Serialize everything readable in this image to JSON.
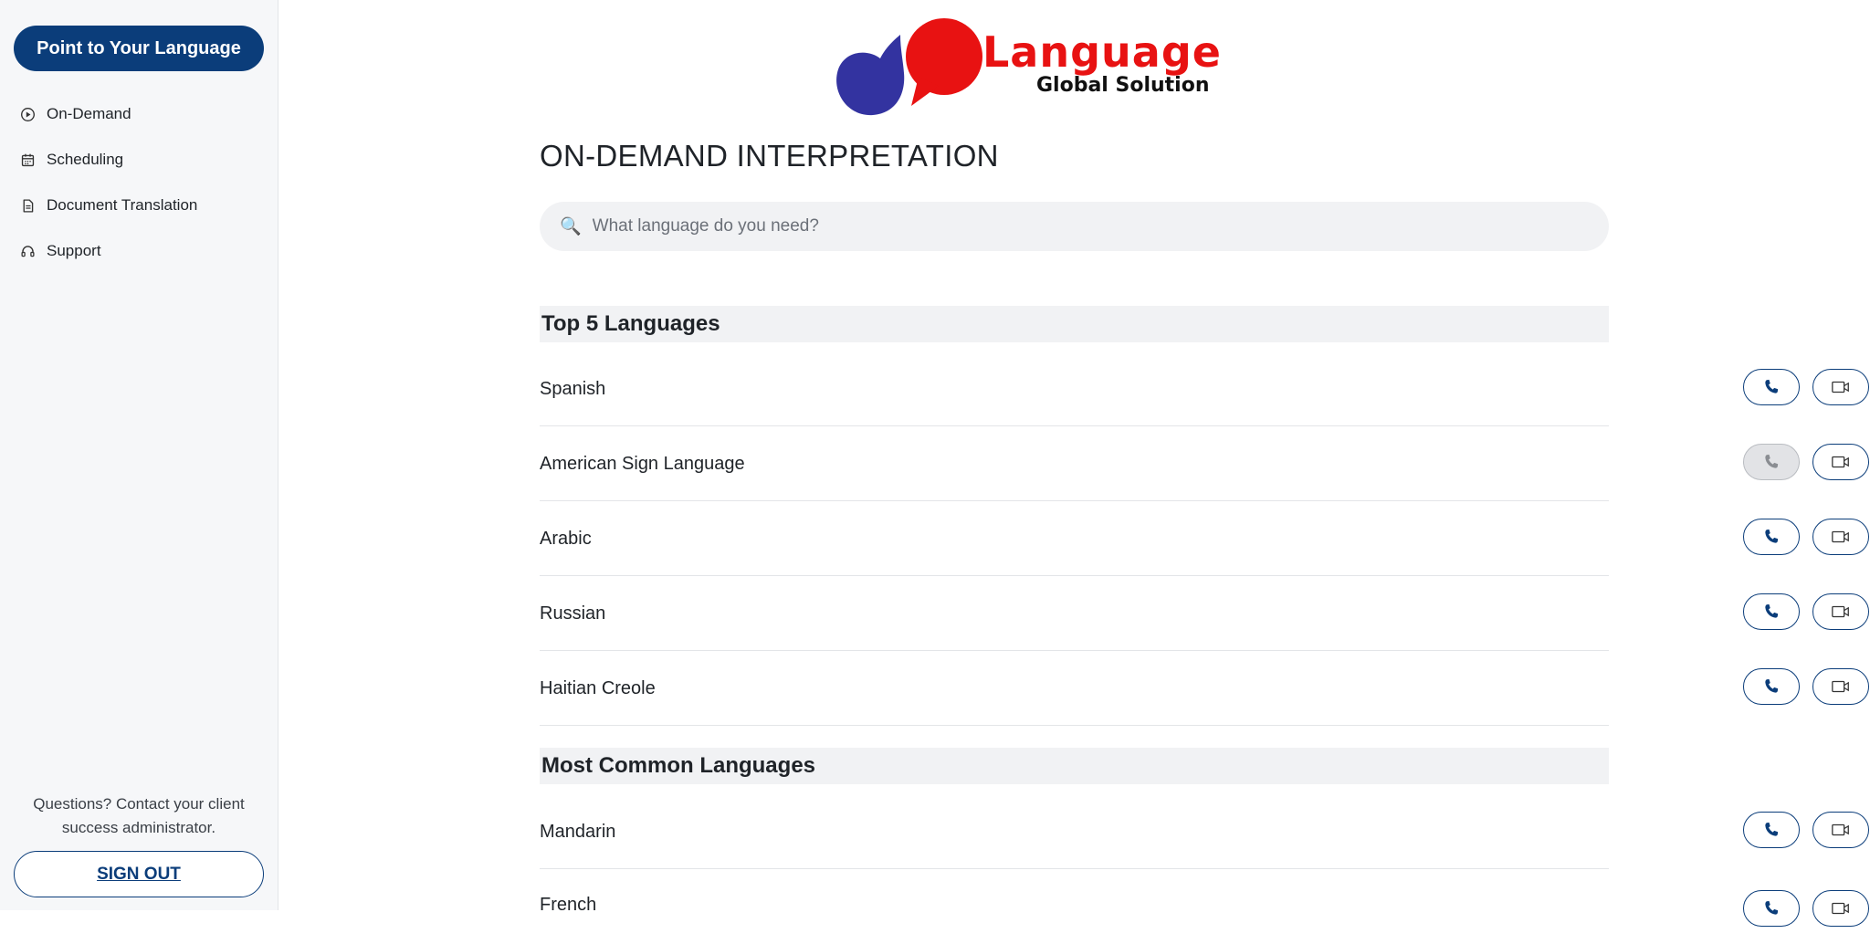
{
  "sidebar": {
    "brand_label": "Point to Your Language",
    "items": [
      {
        "label": "On-Demand",
        "icon": "play-circle-icon"
      },
      {
        "label": "Scheduling",
        "icon": "calendar-icon"
      },
      {
        "label": "Document Translation",
        "icon": "document-icon"
      },
      {
        "label": "Support",
        "icon": "headset-icon"
      }
    ],
    "help_text": "Questions? Contact your client success administrator.",
    "signout_label": "SIGN OUT"
  },
  "logo": {
    "word": "Language",
    "tagline": "Global Solution",
    "colors": {
      "left_bubble": "#3333a0",
      "right_bubble": "#e81212"
    }
  },
  "main": {
    "title": "ON-DEMAND INTERPRETATION",
    "search": {
      "placeholder": "What language do you need?",
      "value": ""
    },
    "sections": [
      {
        "heading": "Top 5 Languages",
        "languages": [
          {
            "name": "Spanish",
            "call_enabled": true,
            "video_enabled": true
          },
          {
            "name": "American Sign Language",
            "call_enabled": false,
            "video_enabled": true
          },
          {
            "name": "Arabic",
            "call_enabled": true,
            "video_enabled": true
          },
          {
            "name": "Russian",
            "call_enabled": true,
            "video_enabled": true
          },
          {
            "name": "Haitian Creole",
            "call_enabled": true,
            "video_enabled": true
          }
        ]
      },
      {
        "heading": "Most Common Languages",
        "languages": [
          {
            "name": "Mandarin",
            "call_enabled": true,
            "video_enabled": true
          },
          {
            "name": "French",
            "call_enabled": true,
            "video_enabled": true
          }
        ]
      }
    ]
  },
  "colors": {
    "accent": "#0b3d7a",
    "disabled": "#e2e3e6"
  }
}
